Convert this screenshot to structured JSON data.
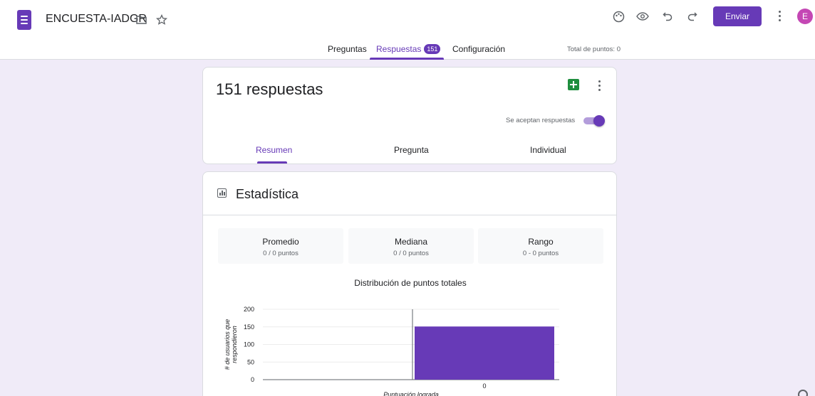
{
  "header": {
    "title": "ENCUESTA-IADGR",
    "send_label": "Enviar",
    "avatar_letter": "E",
    "icons": [
      "forms-logo-icon",
      "folder-icon",
      "star-icon",
      "palette-icon",
      "preview-eye-icon",
      "undo-icon",
      "redo-icon",
      "more-vert-icon"
    ]
  },
  "tabs": {
    "questions": "Preguntas",
    "responses": "Respuestas",
    "responses_badge": "151",
    "settings": "Configuración",
    "total_points": "Total de puntos: 0"
  },
  "summary_card": {
    "count_text": "151 respuestas",
    "accepting_label": "Se aceptan respuestas",
    "accepting": true,
    "subtabs": [
      "Resumen",
      "Pregunta",
      "Individual"
    ],
    "active_subtab": "Resumen"
  },
  "stats_card": {
    "title": "Estadística",
    "boxes": [
      {
        "label": "Promedio",
        "value": "0 / 0 puntos"
      },
      {
        "label": "Mediana",
        "value": "0 / 0 puntos"
      },
      {
        "label": "Rango",
        "value": "0 - 0 puntos"
      }
    ],
    "chart_title": "Distribución de puntos totales"
  },
  "colors": {
    "accent": "#673ab7",
    "background": "#f0ebf8",
    "bar": "#673ab7"
  },
  "chart_data": {
    "type": "bar",
    "title": "Distribución de puntos totales",
    "xlabel": "Puntuación lograda",
    "ylabel": "# de usuarios que respondieron",
    "categories": [
      "0"
    ],
    "values": [
      151
    ],
    "ylim": [
      0,
      200
    ],
    "yticks": [
      0,
      50,
      100,
      150,
      200
    ],
    "grid": true
  }
}
